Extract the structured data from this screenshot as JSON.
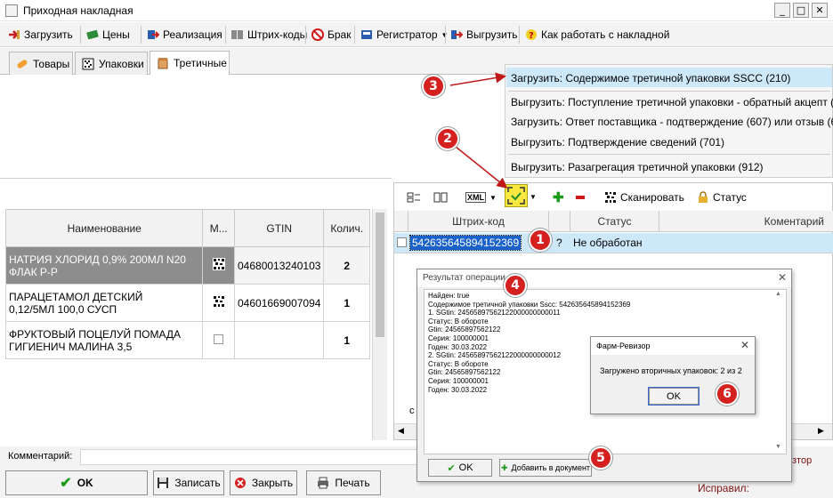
{
  "window": {
    "title": "Приходная накладная",
    "controls": [
      "_",
      "□",
      "✕"
    ]
  },
  "toolbar": {
    "load": "Загрузить",
    "prices": "Цены",
    "sale": "Реализация",
    "barcodes": "Штрих-коды",
    "defect": "Брак",
    "registrar": "Регистратор",
    "unload": "Выгрузить",
    "help": "Как работать с накладной"
  },
  "tabs": [
    "Товары",
    "Упаковки",
    "Третичные"
  ],
  "menu": {
    "items": [
      "Загрузить: Содержимое третичной упаковки SSCC (210)",
      "Выгрузить: Поступление третичной упаковки - обратный акцепт (",
      "Загрузить: Ответ поставщика - подтверждение (607) или отзыв (6",
      "Выгрузить: Подтверждение сведений (701)",
      "Выгрузить: Разагрегация третичной упаковки (912)"
    ]
  },
  "left_table": {
    "headers": [
      "Наименование",
      "М...",
      "GTIN",
      "Колич."
    ],
    "rows": [
      {
        "name1": "НАТРИЯ ХЛОРИД 0,9% 200МЛ N20",
        "name2": "ФЛАК Р-Р",
        "gtin": "04680013240103",
        "qty": "2"
      },
      {
        "name1": "ПАРАЦЕТАМОЛ ДЕТСКИЙ",
        "name2": "0,12/5МЛ 100,0 СУСП",
        "gtin": "04601669007094",
        "qty": "1"
      },
      {
        "name1": "ФРУКТОВЫЙ ПОЦЕЛУЙ ПОМАДА",
        "name2": "ГИГИЕНИЧ МАЛИНА 3,5",
        "gtin": "",
        "qty": "1"
      }
    ]
  },
  "right_toolbar": {
    "xml": "XML",
    "scan": "Сканировать",
    "status": "Статус"
  },
  "right_table": {
    "headers": [
      "Штрих-код",
      "Статус",
      "Коментарий"
    ],
    "row": {
      "barcode": "542635645894152369",
      "flag": "?",
      "status": "Не обработан"
    },
    "cut": "с"
  },
  "result_dialog": {
    "title": "Результат операции",
    "lines": [
      "Найден: true",
      "Содержимое третичной упаковки Sscc: 542635645894152369",
      "1. SGtin: 24565897562122000000000011",
      "Статус: В обороте",
      "Gtin: 24565897562122",
      "Серия: 100000001",
      "Годен: 30.03.2022",
      "2. SGtin: 24565897562122000000000012",
      "Статус: В обороте",
      "Gtin: 24565897562122",
      "Серия: 100000001",
      "Годен: 30.03.2022"
    ],
    "ok": "OK",
    "add": "Добавить в документ"
  },
  "msgbox": {
    "title": "Фарм-Ревизор",
    "text": "Загружено вторичных упаковок: 2  из 2",
    "ok": "OK"
  },
  "comment_label": "Комментарий:",
  "bottom": {
    "ok": "OK",
    "save": "Записать",
    "close": "Закрыть",
    "print": "Печать"
  },
  "bottom_right": {
    "text1": "зтор",
    "text2": "Исправил:"
  },
  "callouts": [
    "1",
    "2",
    "3",
    "4",
    "5",
    "6"
  ],
  "colors": {
    "accent_red": "#d52020",
    "highlight_blue": "#cde8f8",
    "selected_row": "#8d8d8d",
    "barcode_sel": "#1a62c9"
  }
}
